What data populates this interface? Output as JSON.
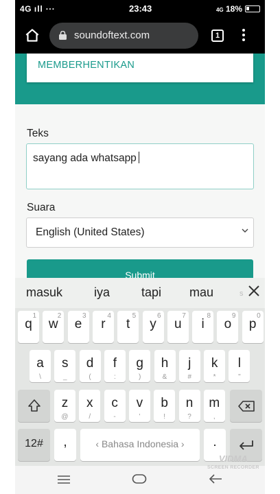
{
  "status_bar": {
    "network": "4G",
    "more": "···",
    "time": "23:43",
    "battery_percent": "18%",
    "data_icon": "4G"
  },
  "browser": {
    "url": "soundoftext.com",
    "tab_count": "1"
  },
  "page": {
    "stop_button_label": "MEMBERHENTIKAN",
    "text_label": "Teks",
    "text_value": "sayang ada whatsapp",
    "voice_label": "Suara",
    "voice_selected": "English (United States)",
    "submit_label": "Submit"
  },
  "keyboard": {
    "suggestions": [
      "masuk",
      "iya",
      "tapi",
      "mau",
      "s"
    ],
    "row1": [
      {
        "main": "q",
        "sub": "1"
      },
      {
        "main": "w",
        "sub": "2"
      },
      {
        "main": "e",
        "sub": "3"
      },
      {
        "main": "r",
        "sub": "4"
      },
      {
        "main": "t",
        "sub": "5"
      },
      {
        "main": "y",
        "sub": "6"
      },
      {
        "main": "u",
        "sub": "7"
      },
      {
        "main": "i",
        "sub": "8"
      },
      {
        "main": "o",
        "sub": "9"
      },
      {
        "main": "p",
        "sub": "0"
      }
    ],
    "row2": [
      {
        "main": "a",
        "sub": "\\"
      },
      {
        "main": "s",
        "sub": "_"
      },
      {
        "main": "d",
        "sub": "("
      },
      {
        "main": "f",
        "sub": ":"
      },
      {
        "main": "g",
        "sub": ")"
      },
      {
        "main": "h",
        "sub": "&"
      },
      {
        "main": "j",
        "sub": "#"
      },
      {
        "main": "k",
        "sub": "*"
      },
      {
        "main": "l",
        "sub": "\""
      }
    ],
    "row3": [
      {
        "main": "z",
        "sub": "@"
      },
      {
        "main": "x",
        "sub": "/"
      },
      {
        "main": "c",
        "sub": "-"
      },
      {
        "main": "v",
        "sub": "'"
      },
      {
        "main": "b",
        "sub": "!"
      },
      {
        "main": "n",
        "sub": "?"
      },
      {
        "main": "m",
        "sub": ","
      }
    ],
    "symbols_label": "12#",
    "comma_label": ",",
    "space_label": "Bahasa Indonesia",
    "period_label": "."
  },
  "watermark": {
    "brand": "VIDMA",
    "caption": "SCREEN RECORDER"
  },
  "icons": [
    "home-icon",
    "lock-icon",
    "tabs-icon",
    "more-vert-icon",
    "chevron-down-icon",
    "close-icon",
    "shift-icon",
    "backspace-icon",
    "enter-icon",
    "menu-icon",
    "home-pill-icon",
    "back-icon"
  ],
  "colors": {
    "accent": "#199a8b",
    "toolbar": "#000000",
    "keyboard_bg": "#e4e6e4"
  }
}
